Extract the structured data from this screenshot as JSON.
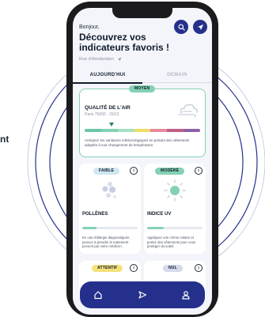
{
  "background": {
    "partial_text": "nt"
  },
  "header": {
    "greeting": "Bonjour,",
    "title": "Découvrez vos indicateurs favoris !",
    "location": "Rue d'Amsterdam"
  },
  "tabs": [
    {
      "label": "AUJOURD'HUI",
      "active": true
    },
    {
      "label": "DEMAIN",
      "active": false
    }
  ],
  "air_card": {
    "badge": "MOYEN",
    "title": "QUALITÉ DE L'AIR",
    "subtitle": "Paris 75000 · 29/12",
    "gauge_colors": [
      "#6cc6a6",
      "#84d1b3",
      "#a8dfc7",
      "#f0dc6a",
      "#e88a9a",
      "#c15d86",
      "#8d5fa3"
    ],
    "pointer_index": 1,
    "description": "Anticipez les variations météorologiques en portant des vêtements adaptés à tout changement de température."
  },
  "pollen_card": {
    "badge": "FAIBLE",
    "title": "POLLÈNES",
    "bar_percent": 25,
    "bar_color": "#84d1b3",
    "description": "En cas d'allergie diagnostiquée, pensez à prendre le traitement prescrit par votre médecin."
  },
  "uv_card": {
    "badge": "MODÉRÉ",
    "title": "INDICE UV",
    "bar_percent": 30,
    "bar_color": "#84d1b3",
    "description": "Appliquez une crème solaire et portez des vêtements pour vous protéger du soleil."
  },
  "row3": [
    {
      "badge": "ATTENTIF"
    },
    {
      "badge": "NUL"
    }
  ],
  "colors": {
    "primary": "#25308c",
    "accent": "#84d1b3",
    "background": "#f3f5fa"
  },
  "icons": {
    "search": "search-icon",
    "locate": "location-arrow-icon",
    "home": "home-icon",
    "send": "send-icon",
    "user": "user-icon"
  }
}
